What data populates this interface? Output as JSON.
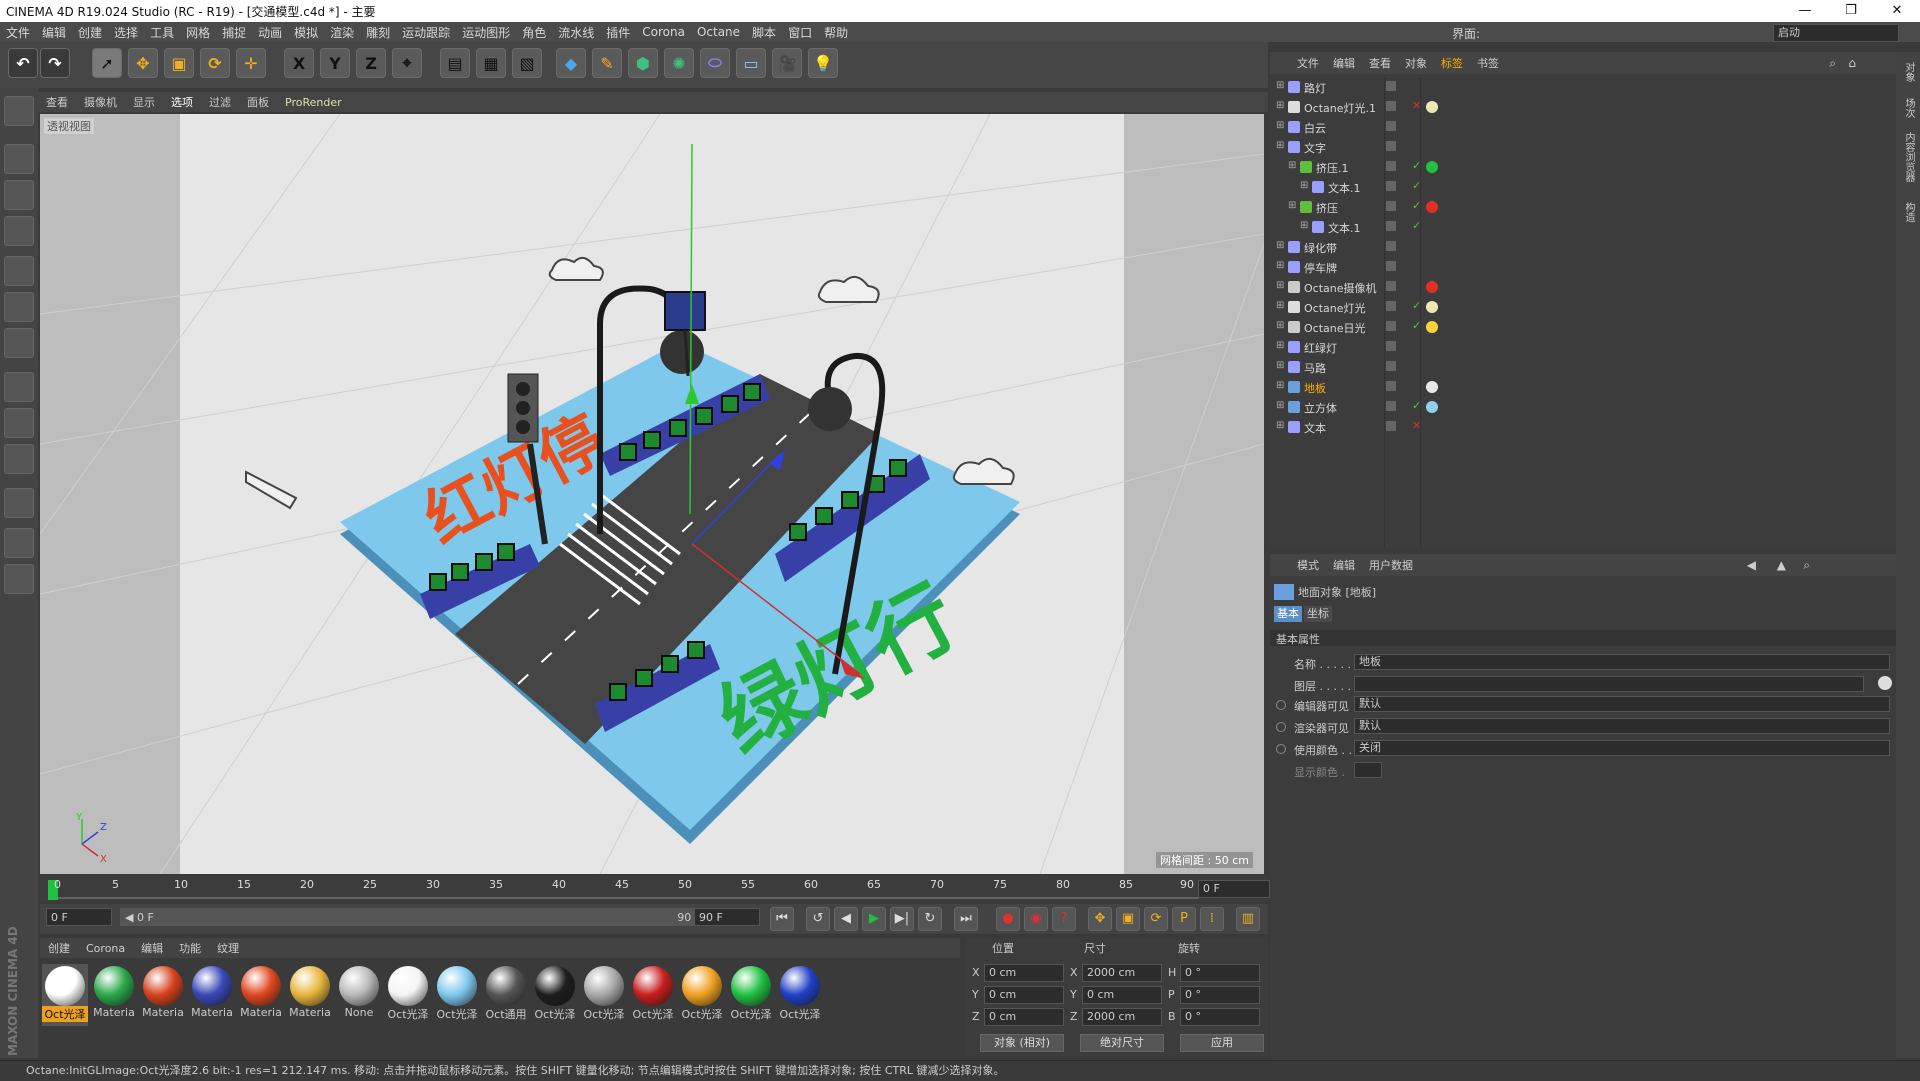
{
  "window": {
    "title": "CINEMA 4D R19.024 Studio (RC - R19) - [交通模型.c4d *] - 主要",
    "controls": [
      "—",
      "❐",
      "✕"
    ]
  },
  "menu": {
    "items": [
      "文件",
      "编辑",
      "创建",
      "选择",
      "工具",
      "网格",
      "捕捉",
      "动画",
      "模拟",
      "渲染",
      "雕刻",
      "运动跟踪",
      "运动图形",
      "角色",
      "流水线",
      "插件",
      "Corona",
      "Octane",
      "脚本",
      "窗口",
      "帮助"
    ],
    "layout_label": "界面:",
    "layout_value": "启动"
  },
  "toolbar": {
    "axis_labels": [
      "X",
      "Y",
      "Z"
    ]
  },
  "viewport": {
    "menu": [
      "查看",
      "摄像机",
      "显示",
      "选项",
      "过滤",
      "面板",
      "ProRender"
    ],
    "active_menu": "选项",
    "label": "透视视图",
    "grid_label": "网格间距 : 50 cm",
    "text_red": "红灯停",
    "text_green": "绿灯行",
    "axes": {
      "y": "Y",
      "z": "Z",
      "x": "X"
    }
  },
  "timeline": {
    "ticks": [
      "0",
      "5",
      "10",
      "15",
      "20",
      "25",
      "30",
      "35",
      "40",
      "45",
      "50",
      "55",
      "60",
      "65",
      "70",
      "75",
      "80",
      "85",
      "90"
    ],
    "current_frame": "0 F",
    "start_field": "0 F",
    "range_start": "◀ 0 F",
    "range_end": "90 F ▶",
    "end_field": "90 F"
  },
  "materials": {
    "menu": [
      "创建",
      "Corona",
      "编辑",
      "功能",
      "纹理"
    ],
    "items": [
      {
        "label": "Oct光泽",
        "color": "#ffffff",
        "selected": true
      },
      {
        "label": "Materia",
        "color": "#2aa84a"
      },
      {
        "label": "Materia",
        "color": "#d6421c"
      },
      {
        "label": "Materia",
        "color": "#3a48b8"
      },
      {
        "label": "Materia",
        "color": "#e0471e"
      },
      {
        "label": "Materia",
        "color": "#e8b53c"
      },
      {
        "label": "None",
        "color": "#b8b8b8"
      },
      {
        "label": "Oct光泽",
        "color": "#f4f4f4"
      },
      {
        "label": "Oct光泽",
        "color": "#7fc8ee"
      },
      {
        "label": "Oct通用",
        "color": "#555555"
      },
      {
        "label": "Oct光泽",
        "color": "#1e1e1e"
      },
      {
        "label": "Oct光泽",
        "color": "#a8a8a8"
      },
      {
        "label": "Oct光泽",
        "color": "#c81e1e"
      },
      {
        "label": "Oct光泽",
        "color": "#f0a020"
      },
      {
        "label": "Oct光泽",
        "color": "#20c040"
      },
      {
        "label": "Oct光泽",
        "color": "#2040c8"
      }
    ]
  },
  "coords": {
    "headers": [
      "位置",
      "尺寸",
      "旋转"
    ],
    "rows": [
      {
        "axis": "X",
        "pos": "0 cm",
        "size_axis": "X",
        "size": "2000 cm",
        "rot_axis": "H",
        "rot": "0 °"
      },
      {
        "axis": "Y",
        "pos": "0 cm",
        "size_axis": "Y",
        "size": "0 cm",
        "rot_axis": "P",
        "rot": "0 °"
      },
      {
        "axis": "Z",
        "pos": "0 cm",
        "size_axis": "Z",
        "size": "2000 cm",
        "rot_axis": "B",
        "rot": "0 °"
      }
    ],
    "mode1": "对象 (相对)",
    "mode2": "绝对尺寸",
    "apply": "应用"
  },
  "status": "Octane:InitGLImage:Oct光泽度2.6  bit:-1 res=1  212.147 ms.     移动: 点击并拖动鼠标移动元素。按住 SHIFT 键量化移动; 节点编辑模式时按住 SHIFT 键增加选择对象; 按住 CTRL 键减少选择对象。",
  "maxon": "MAXON CINEMA 4D",
  "objects": {
    "menu": [
      "文件",
      "编辑",
      "查看",
      "对象",
      "标签",
      "书签"
    ],
    "active_menu": "标签",
    "rows": [
      {
        "name": "路灯",
        "indent": 0,
        "icon": "#9aa0ff",
        "mark": ""
      },
      {
        "name": "Octane灯光.1",
        "indent": 0,
        "icon": "#dddddd",
        "mark": "x",
        "tag": "#f0e6b0"
      },
      {
        "name": "白云",
        "indent": 0,
        "icon": "#9aa0ff",
        "mark": ""
      },
      {
        "name": "文字",
        "indent": 0,
        "icon": "#9aa0ff",
        "mark": ""
      },
      {
        "name": "挤压.1",
        "indent": 1,
        "icon": "#5fbf3c",
        "mark": "ck",
        "tag": "#20c040"
      },
      {
        "name": "文本.1",
        "indent": 2,
        "icon": "#9aa0ff",
        "mark": "ck"
      },
      {
        "name": "挤压",
        "indent": 1,
        "icon": "#5fbf3c",
        "mark": "ck",
        "tag": "#e03020"
      },
      {
        "name": "文本.1",
        "indent": 2,
        "icon": "#9aa0ff",
        "mark": "ck"
      },
      {
        "name": "绿化带",
        "indent": 0,
        "icon": "#9aa0ff",
        "mark": ""
      },
      {
        "name": "停车牌",
        "indent": 0,
        "icon": "#9aa0ff",
        "mark": ""
      },
      {
        "name": "Octane摄像机",
        "indent": 0,
        "icon": "#cccccc",
        "mark": "",
        "tag": "#e03020"
      },
      {
        "name": "Octane灯光",
        "indent": 0,
        "icon": "#dddddd",
        "mark": "ck",
        "tag": "#f0e6b0"
      },
      {
        "name": "Octane日光",
        "indent": 0,
        "icon": "#cccccc",
        "mark": "ck",
        "tag": "#ffd23c"
      },
      {
        "name": "红绿灯",
        "indent": 0,
        "icon": "#9aa0ff",
        "mark": ""
      },
      {
        "name": "马路",
        "indent": 0,
        "icon": "#9aa0ff",
        "mark": ""
      },
      {
        "name": "地板",
        "indent": 0,
        "icon": "#6aa0e0",
        "mark": "",
        "tag": "#e8e8e8",
        "highlight": true
      },
      {
        "name": "立方体",
        "indent": 0,
        "icon": "#6aa0e0",
        "mark": "ck",
        "tag": "#8fd0f0"
      },
      {
        "name": "文本",
        "indent": 0,
        "icon": "#9aa0ff",
        "mark": "x"
      }
    ]
  },
  "attributes": {
    "menu": [
      "模式",
      "编辑",
      "用户数据"
    ],
    "object_title": "地面对象 [地板]",
    "tabs": [
      "基本",
      "坐标"
    ],
    "section": "基本属性",
    "fields": [
      {
        "label": "名称 . . . . .",
        "value": "地板"
      },
      {
        "label": "图层 . . . . .",
        "value": ""
      },
      {
        "label": "编辑器可见",
        "value": "默认"
      },
      {
        "label": "渲染器可见",
        "value": "默认"
      },
      {
        "label": "使用颜色 . .",
        "value": "关闭"
      },
      {
        "label": "显示颜色 .",
        "value": ""
      }
    ]
  },
  "right_strip": [
    "对象",
    "场次",
    "内容浏览器",
    "构造"
  ]
}
